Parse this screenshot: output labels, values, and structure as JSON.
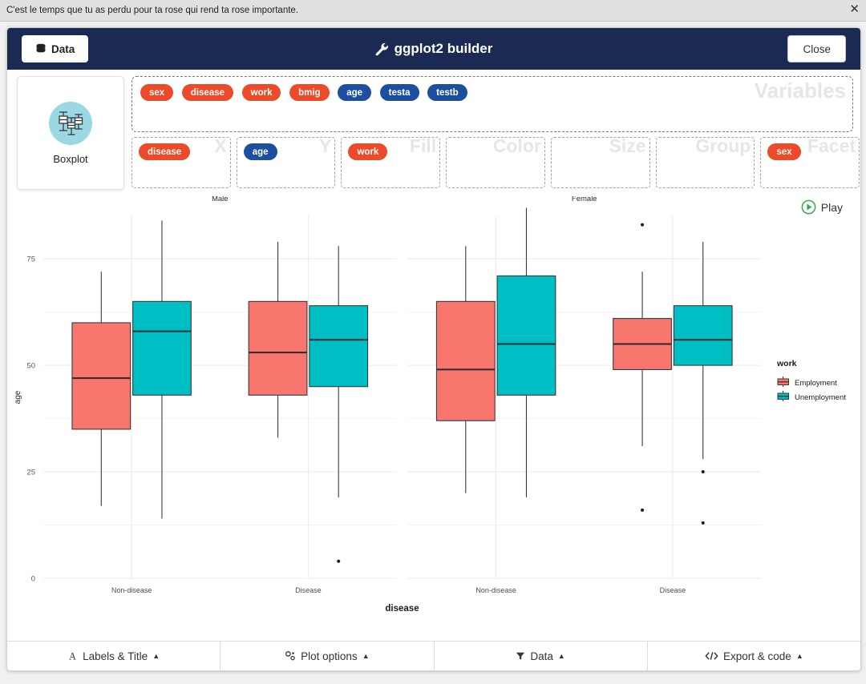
{
  "notification": {
    "message": "C'est le temps que tu as perdu pour ta rose qui rend ta rose importante.",
    "close_icon": "close-icon"
  },
  "header": {
    "data_button": "Data",
    "data_icon": "database-icon",
    "title": "ggplot2 builder",
    "title_icon": "wrench-icon",
    "close_button": "Close"
  },
  "geom": {
    "label": "Boxplot",
    "icon": "boxplot-icon"
  },
  "variables": {
    "watermark": "Variables",
    "items": [
      {
        "label": "sex",
        "type": "categorical"
      },
      {
        "label": "disease",
        "type": "categorical"
      },
      {
        "label": "work",
        "type": "categorical"
      },
      {
        "label": "bmig",
        "type": "categorical"
      },
      {
        "label": "age",
        "type": "numeric"
      },
      {
        "label": "testa",
        "type": "numeric"
      },
      {
        "label": "testb",
        "type": "numeric"
      }
    ]
  },
  "slots": [
    {
      "name": "x",
      "watermark": "X",
      "pill": "disease",
      "pill_type": "categorical"
    },
    {
      "name": "y",
      "watermark": "Y",
      "pill": "age",
      "pill_type": "numeric"
    },
    {
      "name": "fill",
      "watermark": "Fill",
      "pill": "work",
      "pill_type": "categorical"
    },
    {
      "name": "color",
      "watermark": "Color",
      "pill": null,
      "pill_type": null
    },
    {
      "name": "size",
      "watermark": "Size",
      "pill": null,
      "pill_type": null
    },
    {
      "name": "group",
      "watermark": "Group",
      "pill": null,
      "pill_type": null
    },
    {
      "name": "facet",
      "watermark": "Facet",
      "pill": "sex",
      "pill_type": "categorical"
    }
  ],
  "play": {
    "label": "Play",
    "icon": "play-icon"
  },
  "footer": [
    {
      "label": "Labels & Title",
      "icon": "font-icon",
      "caret": "▲"
    },
    {
      "label": "Plot options",
      "icon": "sliders-icon",
      "caret": "▲"
    },
    {
      "label": "Data",
      "icon": "filter-icon",
      "caret": "▲"
    },
    {
      "label": "Export & code",
      "icon": "code-icon",
      "caret": "▲"
    }
  ],
  "colors": {
    "employment": "#F8766D",
    "unemployment": "#00BFC4",
    "header_bg": "#1b2a52",
    "pill_categorical": "#ec4a28",
    "pill_numeric": "#1d4fa0",
    "grid": "#ebebeb",
    "stroke": "#3a3a3a"
  },
  "chart_data": {
    "type": "boxplot",
    "title": "",
    "xlabel": "disease",
    "ylabel": "age",
    "ylim": [
      0,
      85
    ],
    "yticks": [
      0,
      25,
      50,
      75
    ],
    "ytick_labels": [
      "0",
      "25",
      "50",
      "75"
    ],
    "grid": true,
    "facet_var": "sex",
    "facets": [
      "Male",
      "Female"
    ],
    "x_categories": [
      "Non-disease",
      "Disease"
    ],
    "fill_var": "work",
    "legend": {
      "title": "work",
      "position": "right",
      "entries": [
        {
          "label": "Employment",
          "color": "#F8766D"
        },
        {
          "label": "Unemployment",
          "color": "#00BFC4"
        }
      ]
    },
    "boxes": [
      {
        "facet": "Male",
        "x": "Non-disease",
        "fill": "Employment",
        "lower_whisker": 17,
        "q1": 35,
        "median": 47,
        "q3": 60,
        "upper_whisker": 72,
        "outliers": []
      },
      {
        "facet": "Male",
        "x": "Non-disease",
        "fill": "Unemployment",
        "lower_whisker": 14,
        "q1": 43,
        "median": 58,
        "q3": 65,
        "upper_whisker": 84,
        "outliers": []
      },
      {
        "facet": "Male",
        "x": "Disease",
        "fill": "Employment",
        "lower_whisker": 33,
        "q1": 43,
        "median": 53,
        "q3": 65,
        "upper_whisker": 79,
        "outliers": []
      },
      {
        "facet": "Male",
        "x": "Disease",
        "fill": "Unemployment",
        "lower_whisker": 19,
        "q1": 45,
        "median": 56,
        "q3": 64,
        "upper_whisker": 78,
        "outliers": [
          4
        ]
      },
      {
        "facet": "Female",
        "x": "Non-disease",
        "fill": "Employment",
        "lower_whisker": 20,
        "q1": 37,
        "median": 49,
        "q3": 65,
        "upper_whisker": 78,
        "outliers": []
      },
      {
        "facet": "Female",
        "x": "Non-disease",
        "fill": "Unemployment",
        "lower_whisker": 19,
        "q1": 43,
        "median": 55,
        "q3": 71,
        "upper_whisker": 87,
        "outliers": []
      },
      {
        "facet": "Female",
        "x": "Disease",
        "fill": "Employment",
        "lower_whisker": 31,
        "q1": 49,
        "median": 55,
        "q3": 61,
        "upper_whisker": 72,
        "outliers": [
          83,
          16
        ]
      },
      {
        "facet": "Female",
        "x": "Disease",
        "fill": "Unemployment",
        "lower_whisker": 28,
        "q1": 50,
        "median": 56,
        "q3": 64,
        "upper_whisker": 79,
        "outliers": [
          25,
          13
        ]
      }
    ]
  }
}
